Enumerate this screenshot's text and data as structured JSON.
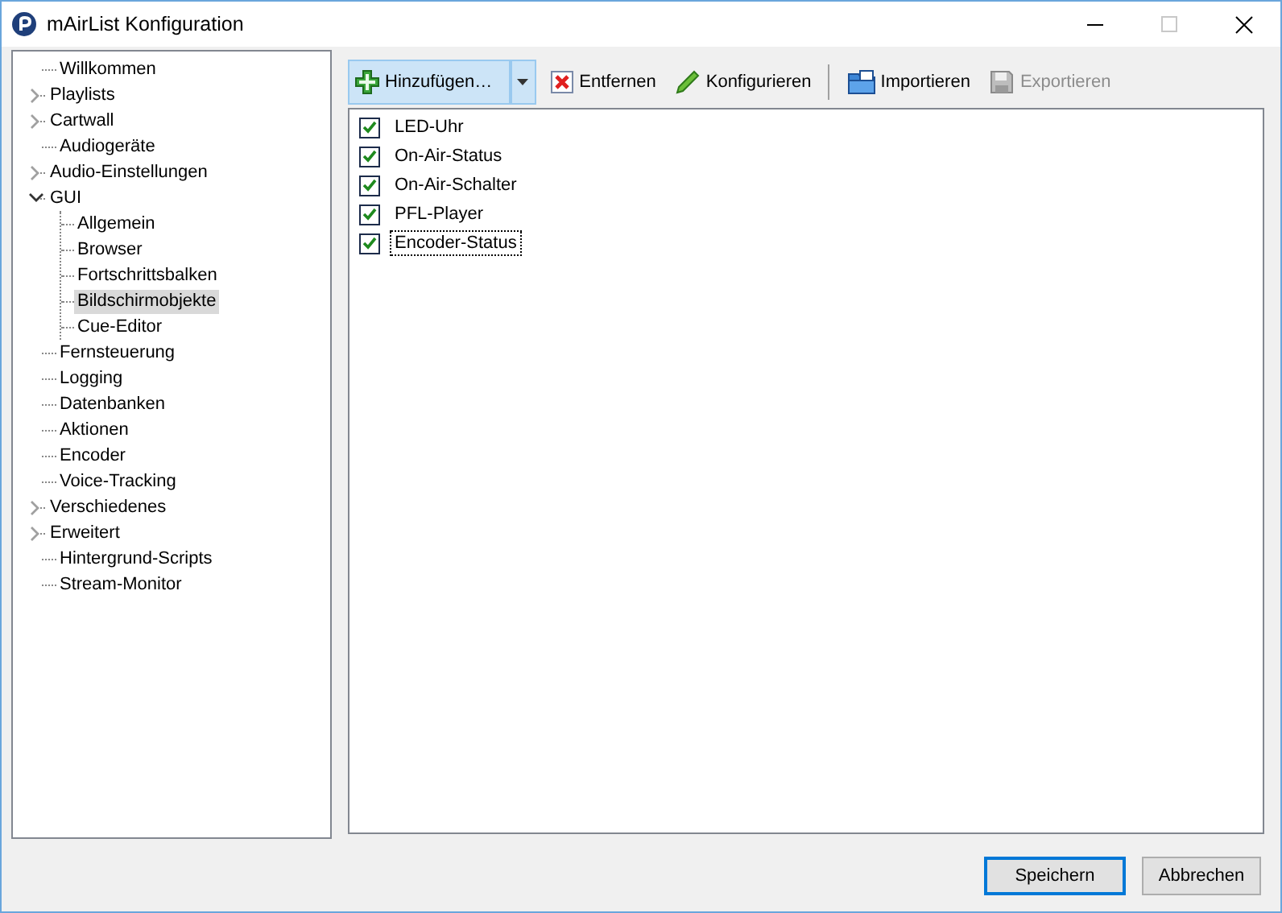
{
  "window": {
    "title": "mAirList Konfiguration"
  },
  "tree": [
    {
      "label": "Willkommen",
      "kind": "leaf",
      "expanded": false,
      "selected": false
    },
    {
      "label": "Playlists",
      "kind": "folder",
      "expanded": false,
      "selected": false
    },
    {
      "label": "Cartwall",
      "kind": "folder",
      "expanded": false,
      "selected": false
    },
    {
      "label": "Audiogeräte",
      "kind": "leaf",
      "expanded": false,
      "selected": false
    },
    {
      "label": "Audio-Einstellungen",
      "kind": "folder",
      "expanded": false,
      "selected": false
    },
    {
      "label": "GUI",
      "kind": "folder",
      "expanded": true,
      "selected": false,
      "children": [
        {
          "label": "Allgemein",
          "expanded": false,
          "selected": false
        },
        {
          "label": "Browser",
          "expanded": false,
          "selected": false
        },
        {
          "label": "Fortschrittsbalken",
          "expanded": false,
          "selected": false
        },
        {
          "label": "Bildschirmobjekte",
          "expanded": false,
          "selected": true
        },
        {
          "label": "Cue-Editor",
          "expanded": false,
          "selected": false
        }
      ]
    },
    {
      "label": "Fernsteuerung",
      "kind": "leaf",
      "expanded": false,
      "selected": false
    },
    {
      "label": "Logging",
      "kind": "leaf",
      "expanded": false,
      "selected": false
    },
    {
      "label": "Datenbanken",
      "kind": "leaf",
      "expanded": false,
      "selected": false
    },
    {
      "label": "Aktionen",
      "kind": "leaf",
      "expanded": false,
      "selected": false
    },
    {
      "label": "Encoder",
      "kind": "leaf",
      "expanded": false,
      "selected": false
    },
    {
      "label": "Voice-Tracking",
      "kind": "leaf",
      "expanded": false,
      "selected": false
    },
    {
      "label": "Verschiedenes",
      "kind": "folder",
      "expanded": false,
      "selected": false
    },
    {
      "label": "Erweitert",
      "kind": "folder",
      "expanded": false,
      "selected": false
    },
    {
      "label": "Hintergrund-Scripts",
      "kind": "leaf",
      "expanded": false,
      "selected": false
    },
    {
      "label": "Stream-Monitor",
      "kind": "leaf",
      "expanded": false,
      "selected": false
    }
  ],
  "toolbar": {
    "groups": [
      [
        {
          "label": "Hinzufügen…",
          "kind": "split",
          "highlighted": true,
          "disabled": false
        },
        {
          "label": "Entfernen",
          "kind": "button",
          "highlighted": false,
          "disabled": false
        },
        {
          "label": "Konfigurieren",
          "kind": "button",
          "highlighted": false,
          "disabled": false
        }
      ],
      [
        {
          "label": "Importieren",
          "kind": "button",
          "highlighted": false,
          "disabled": false
        },
        {
          "label": "Exportieren",
          "kind": "button",
          "highlighted": false,
          "disabled": true
        }
      ]
    ]
  },
  "items": [
    {
      "label": "LED-Uhr",
      "checked": true,
      "focused": false
    },
    {
      "label": "On-Air-Status",
      "checked": true,
      "focused": false
    },
    {
      "label": "On-Air-Schalter",
      "checked": true,
      "focused": false
    },
    {
      "label": "PFL-Player",
      "checked": true,
      "focused": false
    },
    {
      "label": "Encoder-Status",
      "checked": true,
      "focused": true
    }
  ],
  "buttons": [
    {
      "label": "Speichern",
      "default": true
    },
    {
      "label": "Abbrechen",
      "default": false
    }
  ]
}
